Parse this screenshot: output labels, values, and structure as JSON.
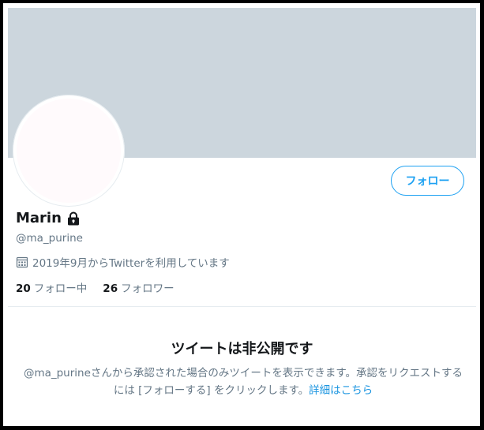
{
  "profile": {
    "follow_button": "フォロー",
    "display_name": "Marin",
    "handle": "@ma_purine",
    "joined": "2019年9月からTwitterを利用しています",
    "following_count": "20",
    "following_label": "フォロー中",
    "followers_count": "26",
    "followers_label": "フォロワー"
  },
  "protected": {
    "title": "ツイートは非公開です",
    "description": "@ma_purineさんから承認された場合のみツイートを表示できます。承認をリクエストするには [フォローする] をクリックします。",
    "learn_more": "詳細はこちら"
  },
  "icons": {
    "lock": "lock-icon",
    "calendar": "calendar-icon"
  },
  "colors": {
    "banner": "#ccd6dd",
    "accent": "#1da1f2",
    "secondary_text": "#657786"
  }
}
